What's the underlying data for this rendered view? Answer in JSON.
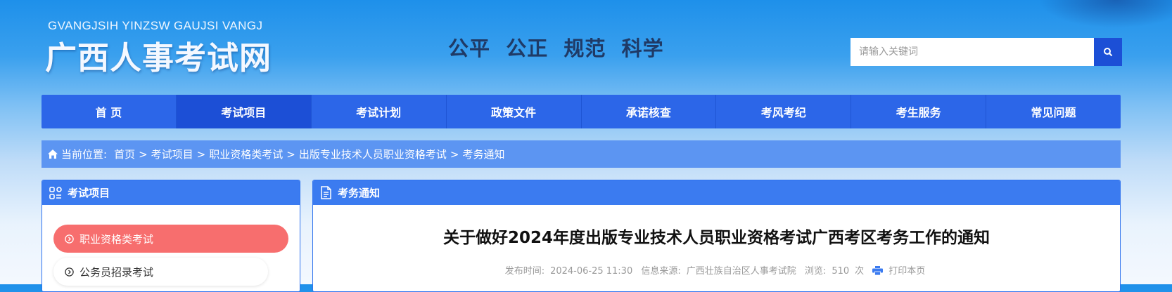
{
  "header": {
    "logo_en": "GVANGJSIH YINZSW GAUJSI VANGJ",
    "logo_cn": "广西人事考试网",
    "slogan": "公平  公正  规范  科学"
  },
  "search": {
    "placeholder": "请输入关键词",
    "icon": "search-icon"
  },
  "nav": {
    "items": [
      {
        "label": "首 页"
      },
      {
        "label": "考试项目"
      },
      {
        "label": "考试计划"
      },
      {
        "label": "政策文件"
      },
      {
        "label": "承诺核查"
      },
      {
        "label": "考风考纪"
      },
      {
        "label": "考生服务"
      },
      {
        "label": "常见问题"
      }
    ],
    "active_index": 1
  },
  "breadcrumb": {
    "prefix": "当前位置:",
    "items": [
      "首页",
      "考试项目",
      "职业资格类考试",
      "出版专业技术人员职业资格考试",
      "考务通知"
    ],
    "separator": ">"
  },
  "sidebar": {
    "title": "考试项目",
    "items": [
      {
        "label": "职业资格类考试"
      },
      {
        "label": "公务员招录考试"
      }
    ]
  },
  "article": {
    "section_title": "考务通知",
    "title": "关于做好2024年度出版专业技术人员职业资格考试广西考区考务工作的通知",
    "publish_label": "发布时间:",
    "publish_time": "2024-06-25 11:30",
    "source_label": "信息来源:",
    "source": "广西壮族自治区人事考试院",
    "views_label": "浏览:",
    "views": "510",
    "views_unit": "次",
    "print_label": "打印本页"
  },
  "colors": {
    "nav_bg": "#2c66e8",
    "nav_active": "#1c4fd6",
    "breadcrumb_bg": "#5c95f2",
    "panel_head": "#3b7bf0",
    "menu_active": "#f76e6e"
  }
}
